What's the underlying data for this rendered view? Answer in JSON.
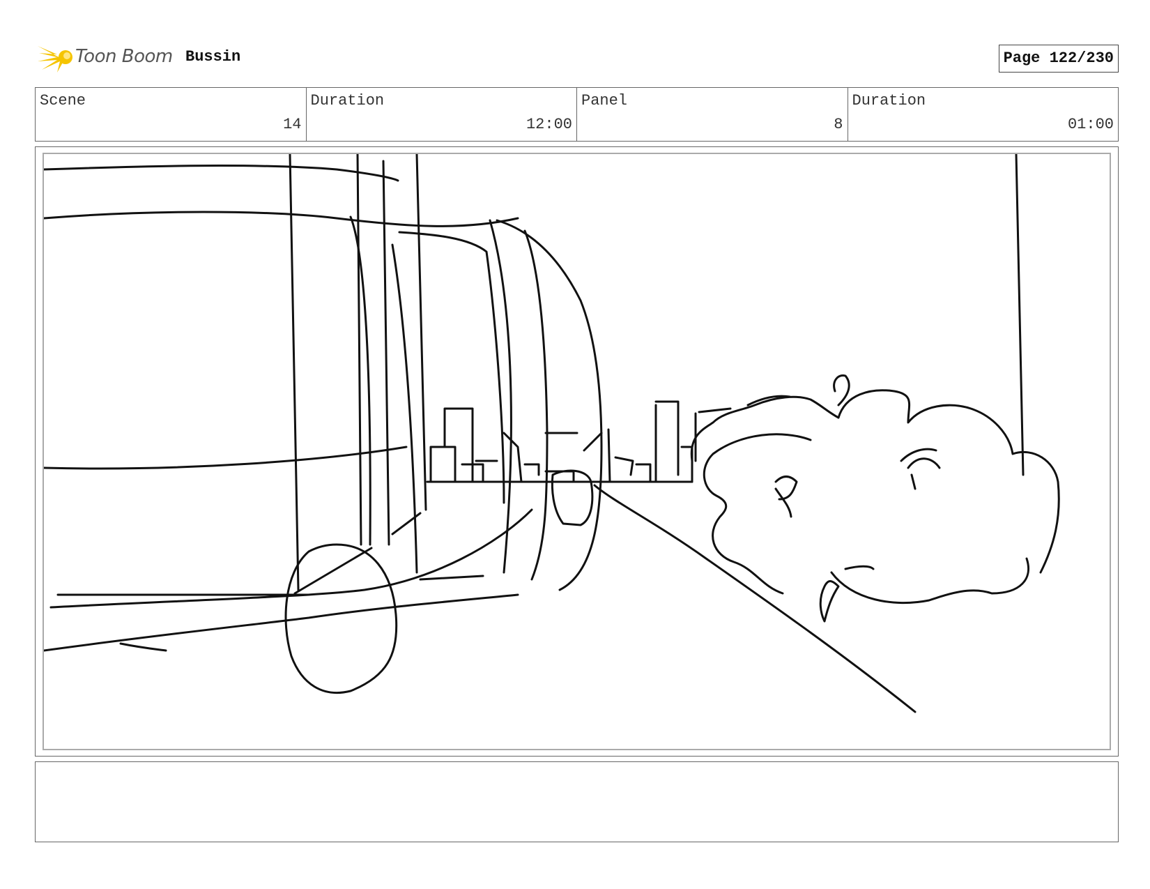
{
  "header": {
    "logo_icon": "toon-boom-star-icon",
    "brand_name": "Toon Boom",
    "project_title": "Bussin",
    "page_label": "Page 122/230"
  },
  "info": {
    "scene_label": "Scene",
    "scene_value": "14",
    "scene_duration_label": "Duration",
    "scene_duration_value": "12:00",
    "panel_label": "Panel",
    "panel_value": "8",
    "panel_duration_label": "Duration",
    "panel_duration_value": "01:00"
  },
  "notes": {
    "text": ""
  },
  "colors": {
    "logo_yellow": "#f5c400",
    "line": "#111111",
    "border": "#666666"
  }
}
